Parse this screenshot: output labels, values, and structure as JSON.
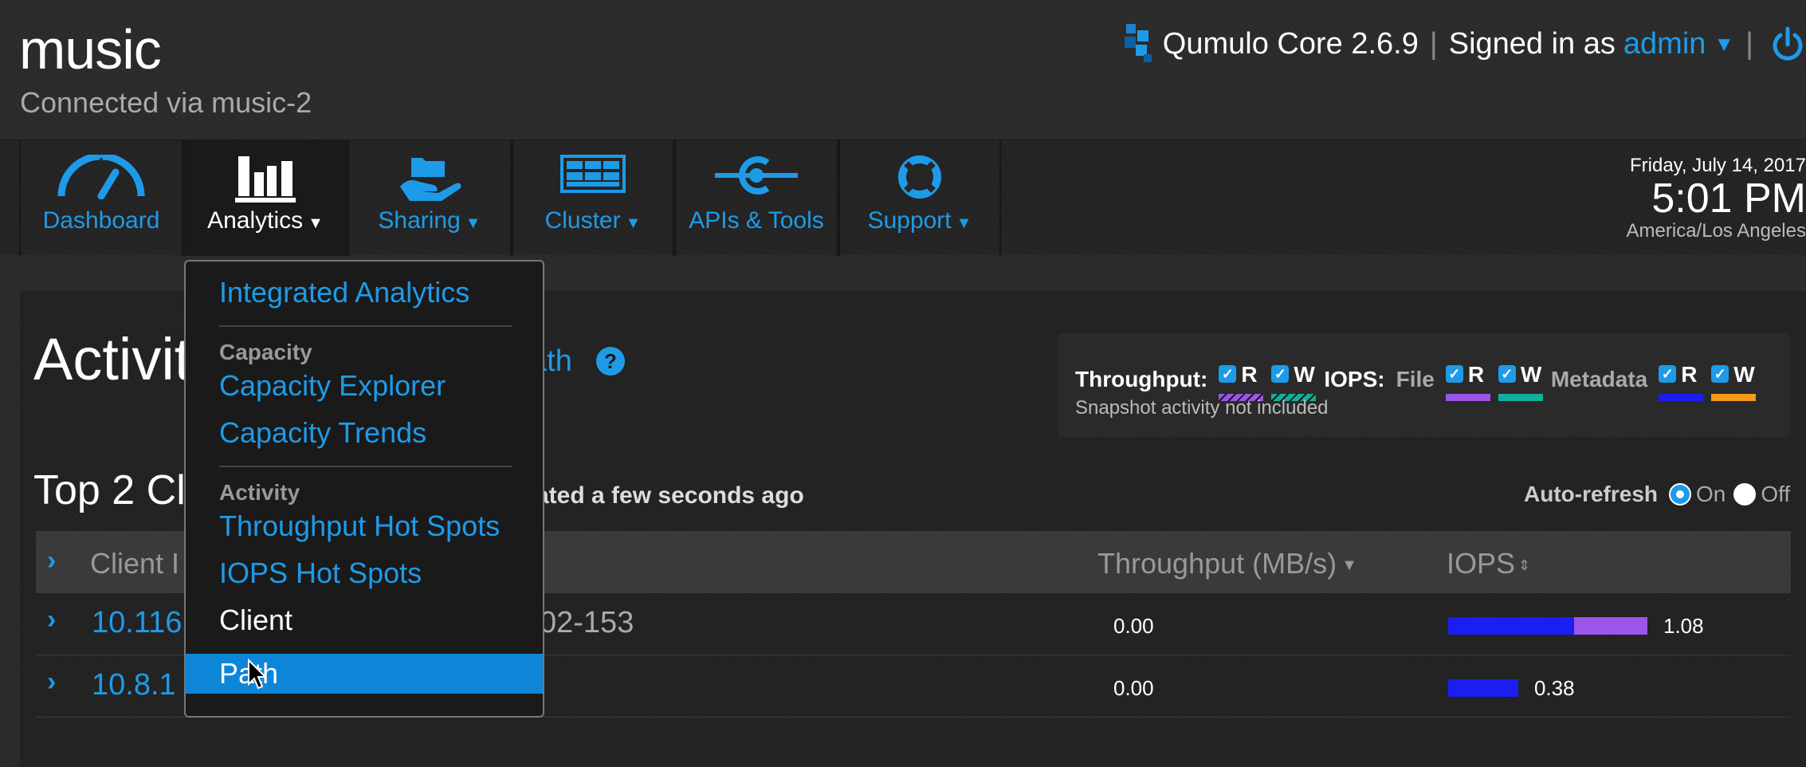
{
  "header": {
    "cluster_name": "music",
    "connected_text": "Connected via music-2",
    "product": "Qumulo Core 2.6.9",
    "signed_in_prefix": "Signed in as",
    "user": "admin",
    "separator": "|"
  },
  "nav": {
    "items": [
      {
        "label": "Dashboard",
        "icon": "gauge-icon"
      },
      {
        "label": "Analytics",
        "icon": "bar-chart-icon",
        "active": true
      },
      {
        "label": "Sharing",
        "icon": "hand-folder-icon"
      },
      {
        "label": "Cluster",
        "icon": "server-rack-icon"
      },
      {
        "label": "APIs & Tools",
        "icon": "api-icon"
      },
      {
        "label": "Support",
        "icon": "lifebuoy-icon"
      }
    ],
    "date": "Friday, July 14, 2017",
    "time": "5:01 PM",
    "timezone": "America/Los Angeles"
  },
  "page": {
    "title": "Activity",
    "title_link_tail": "ath",
    "help": "?"
  },
  "legend": {
    "throughput_label": "Throughput:",
    "iops_label": "IOPS:",
    "file_label": "File",
    "metadata_label": "Metadata",
    "r": "R",
    "w": "W",
    "snapshot_note": "Snapshot activity not included",
    "colors": {
      "tp_r": "#9b55e8",
      "tp_w": "#10b09a",
      "file_r": "#9b55e8",
      "file_w": "#10b09a",
      "meta_r": "#1a1ef0",
      "meta_w": "#f59a1a"
    }
  },
  "clients": {
    "title": "Top 2 Cli",
    "updated_tail": "ated a few seconds ago",
    "autorefresh_label": "Auto-refresh",
    "on": "On",
    "off": "Off",
    "columns": {
      "ip": "Client I",
      "throughput": "Throughput (MB/s)",
      "iops": "IOPS"
    },
    "rows": [
      {
        "ip": "10.116",
        "host": "02-153",
        "throughput": "0.00",
        "iops": "1.08",
        "iops_read_fraction": 0.63,
        "iops_write_fraction": 0.37
      },
      {
        "ip": "10.8.1",
        "host": "",
        "throughput": "0.00",
        "iops": "0.38",
        "iops_read_fraction": 1.0,
        "iops_write_fraction": 0.0
      }
    ]
  },
  "dropdown": {
    "integrated": "Integrated Analytics",
    "capacity_heading": "Capacity",
    "capacity_explorer": "Capacity Explorer",
    "capacity_trends": "Capacity Trends",
    "activity_heading": "Activity",
    "throughput_hot_spots": "Throughput Hot Spots",
    "iops_hot_spots": "IOPS Hot Spots",
    "client": "Client",
    "path": "Path"
  }
}
